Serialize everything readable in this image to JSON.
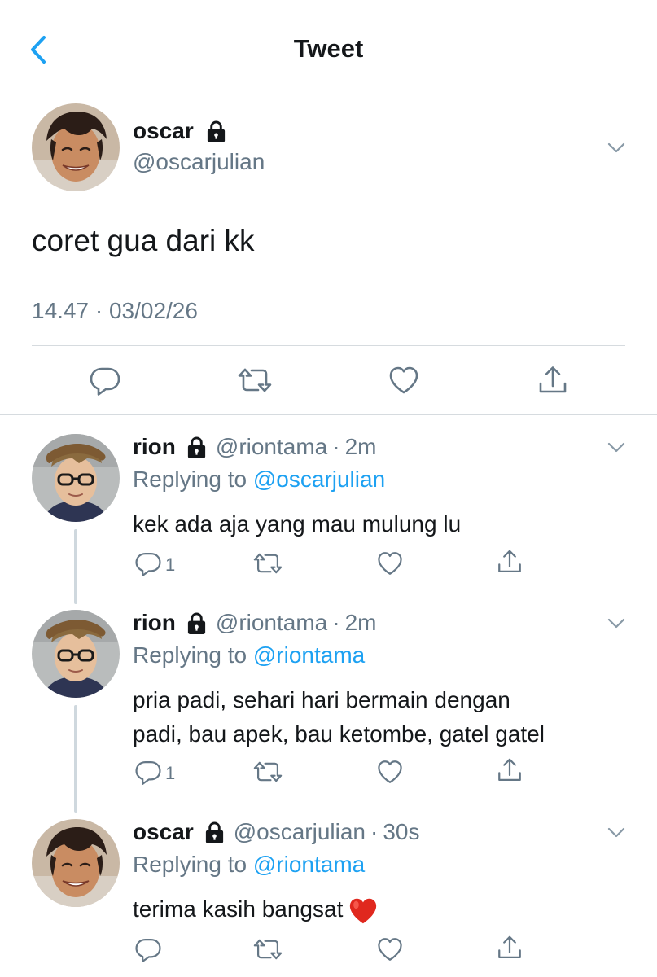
{
  "header": {
    "title": "Tweet"
  },
  "main_tweet": {
    "name": "oscar",
    "handle": "@oscarjulian",
    "text": "coret gua dari kk",
    "timestamp": "14.47 · 03/02/26"
  },
  "replies": [
    {
      "name": "rion",
      "handle": "@riontama",
      "dot": "·",
      "time": "2m",
      "replying_prefix": "Replying to ",
      "replying_to": "@oscarjulian",
      "text": "kek ada aja yang mau mulung lu",
      "reply_count": "1"
    },
    {
      "name": "rion",
      "handle": "@riontama",
      "dot": "·",
      "time": "2m",
      "replying_prefix": "Replying to ",
      "replying_to": "@riontama",
      "text_line1": "pria padi, sehari hari bermain dengan",
      "text_line2": "padi, bau apek, bau ketombe, gatel gatel",
      "reply_count": "1"
    },
    {
      "name": "oscar",
      "handle": "@oscarjulian",
      "dot": "·",
      "time": "30s",
      "replying_prefix": "Replying to ",
      "replying_to": "@riontama",
      "text": "terima kasih bangsat",
      "emoji": "red-heart"
    }
  ],
  "colors": {
    "accent": "#1da1f2",
    "text": "#14171a",
    "muted": "#657786",
    "divider": "#d6dbdf",
    "heart_emoji": "#e0281e"
  },
  "icons": [
    "chevron-left-icon",
    "lock-icon",
    "chevron-down-icon",
    "reply-icon",
    "retweet-icon",
    "like-icon",
    "share-icon",
    "red-heart-emoji"
  ]
}
